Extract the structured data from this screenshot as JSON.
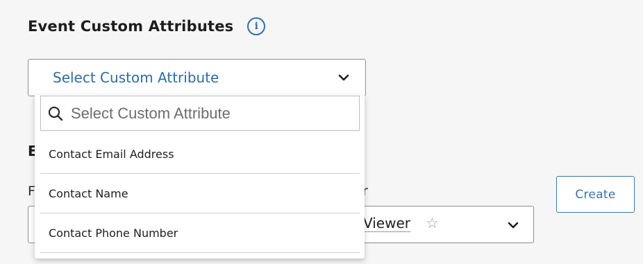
{
  "section": {
    "title": "Event Custom Attributes",
    "info_icon": "info-circle-icon"
  },
  "attribute_select": {
    "label": "Select Custom Attribute",
    "icon": "chevron-down-icon"
  },
  "dropdown": {
    "search_placeholder": "Select Custom Attribute",
    "search_value": "",
    "options": [
      {
        "label": "Contact Email Address"
      },
      {
        "label": "Contact Name"
      },
      {
        "label": "Contact Phone Number"
      }
    ]
  },
  "background": {
    "heading_fragment": "E",
    "label_left_fragment": "F",
    "label_right_fragment": "r",
    "viewer_value": "Viewer",
    "viewer_star": "☆",
    "create_label": "Create"
  },
  "colors": {
    "accent": "#2e6fb0",
    "select_text": "#2f6ba3",
    "background": "#f6f6f6"
  }
}
